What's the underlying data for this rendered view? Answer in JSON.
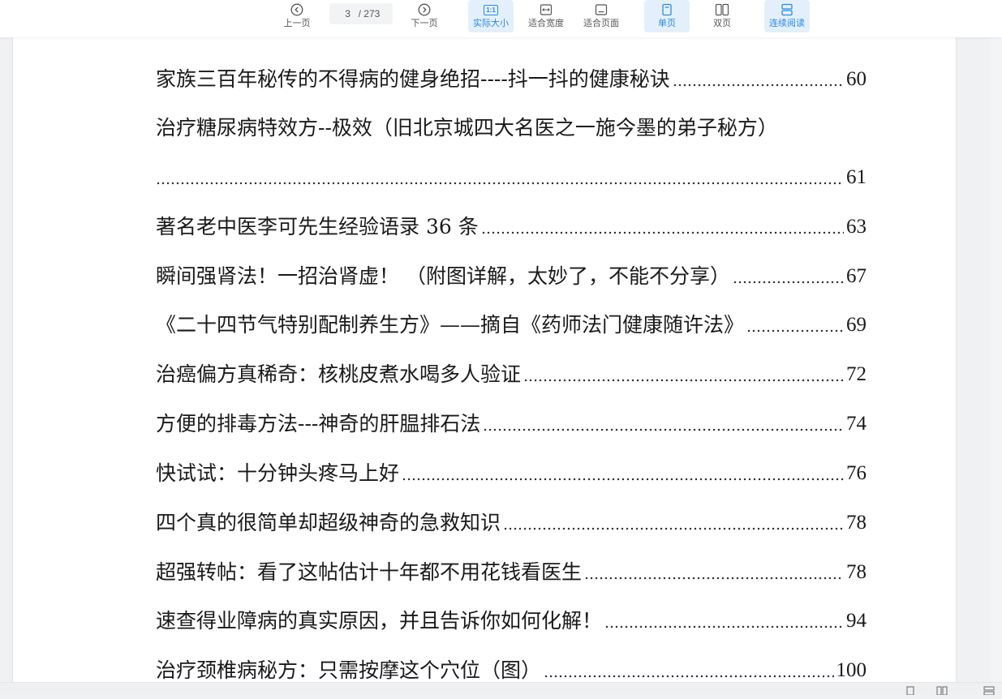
{
  "toolbar": {
    "prev_label": "上一页",
    "next_label": "下一页",
    "current_page": "3",
    "total_pages": "/ 273",
    "actual_size_label": "实际大小",
    "actual_size_icon": "1:1",
    "fit_width_label": "适合宽度",
    "fit_page_label": "适合页面",
    "single_page_label": "单页",
    "double_page_label": "双页",
    "continuous_label": "连续阅读",
    "accent_color": "#2a8ae0",
    "active_bg": "#e3f0fb"
  },
  "toc": [
    {
      "title": "家族三百年秘传的不得病的健身绝招----抖一抖的健康秘诀",
      "page": "60"
    },
    {
      "title": "治疗糖尿病特效方--极效（旧北京城四大名医之一施今墨的弟子秘方）",
      "page": ""
    },
    {
      "title": "",
      "page": "61"
    },
    {
      "title": "著名老中医李可先生经验语录 36 条",
      "page": "63"
    },
    {
      "title": "瞬间强肾法！一招治肾虚！ （附图详解，太妙了，不能不分享）",
      "page": "67"
    },
    {
      "title": "《二十四节气特别配制养生方》——摘自《药师法门健康随许法》",
      "page": "69"
    },
    {
      "title": "治癌偏方真稀奇：核桃皮煮水喝多人验证",
      "page": "72"
    },
    {
      "title": "方便的排毒方法---神奇的肝腽排石法",
      "page": "74"
    },
    {
      "title": "快试试：十分钟头疼马上好",
      "page": "76"
    },
    {
      "title": "四个真的很简单却超级神奇的急救知识",
      "page": "78"
    },
    {
      "title": "超强转帖：看了这帖估计十年都不用花钱看医生",
      "page": "78"
    },
    {
      "title": "速查得业障病的真实原因，并且告诉你如何化解！",
      "page": "94"
    },
    {
      "title": "治疗颈椎病秘方：只需按摩这个穴位（图）",
      "page": "100"
    }
  ]
}
